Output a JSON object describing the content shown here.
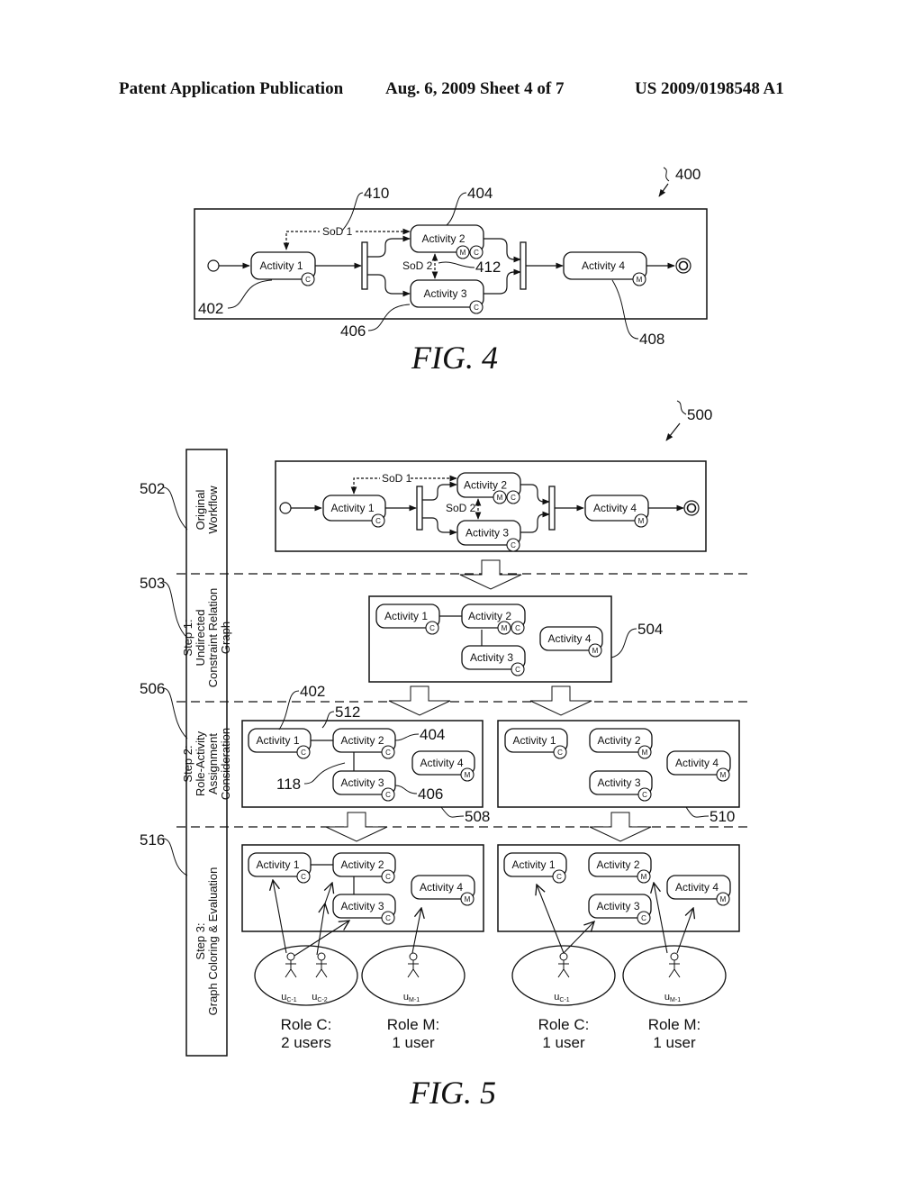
{
  "header": {
    "left": "Patent Application Publication",
    "middle": "Aug. 6, 2009   Sheet 4 of 7",
    "right": "US 2009/0198548 A1"
  },
  "fig4": {
    "caption": "FIG. 4",
    "ref_figure": "400",
    "refs": {
      "activity1": "402",
      "activity2": "404",
      "activity3": "406",
      "activity4": "408",
      "sod1": "410",
      "sod2": "412"
    },
    "activities": [
      {
        "label": "Activity 1",
        "badges": [
          "C"
        ]
      },
      {
        "label": "Activity 2",
        "badges": [
          "M",
          "C"
        ]
      },
      {
        "label": "Activity 3",
        "badges": [
          "C"
        ]
      },
      {
        "label": "Activity 4",
        "badges": [
          "M"
        ]
      }
    ],
    "sod1": "SoD 1",
    "sod2": "SoD 2"
  },
  "fig5": {
    "caption": "FIG. 5",
    "ref_figure": "500",
    "steps": [
      {
        "ref": "502",
        "lines": [
          "Original",
          "Workflow"
        ]
      },
      {
        "ref": "503",
        "lines": [
          "Step 1:",
          "Undirected",
          "Constraint Relation",
          "Graph"
        ]
      },
      {
        "ref": "506",
        "lines": [
          "Step 2:",
          "Role-Activity",
          "Assignment",
          "Consideration"
        ]
      },
      {
        "ref": "516",
        "lines": [
          "Step 3:",
          "Graph Coloring & Evaluation"
        ]
      }
    ],
    "workflow": {
      "activities": [
        {
          "label": "Activity 1",
          "badges": [
            "C"
          ]
        },
        {
          "label": "Activity 2",
          "badges": [
            "M",
            "C"
          ]
        },
        {
          "label": "Activity 3",
          "badges": [
            "C"
          ]
        },
        {
          "label": "Activity 4",
          "badges": [
            "M"
          ]
        }
      ],
      "sod1": "SoD 1",
      "sod2": "SoD 2"
    },
    "graph": {
      "ref": "504",
      "activities": [
        {
          "label": "Activity 1",
          "badges": [
            "C"
          ]
        },
        {
          "label": "Activity 2",
          "badges": [
            "M",
            "C"
          ]
        },
        {
          "label": "Activity 3",
          "badges": [
            "C"
          ]
        },
        {
          "label": "Activity 4",
          "badges": [
            "M"
          ]
        }
      ]
    },
    "step2_left": {
      "ref": "508",
      "refs": {
        "activity1": "402",
        "activity2": "404",
        "activity3": "406",
        "edge12": "512",
        "edge23": "118"
      },
      "activities": [
        {
          "label": "Activity 1",
          "badges": [
            "C"
          ]
        },
        {
          "label": "Activity 2",
          "badges": [
            "C"
          ]
        },
        {
          "label": "Activity 3",
          "badges": [
            "C"
          ]
        },
        {
          "label": "Activity 4",
          "badges": [
            "M"
          ]
        }
      ]
    },
    "step2_right": {
      "ref": "510",
      "activities": [
        {
          "label": "Activity 1",
          "badges": [
            "C"
          ]
        },
        {
          "label": "Activity 2",
          "badges": [
            "M"
          ]
        },
        {
          "label": "Activity 3",
          "badges": [
            "C"
          ]
        },
        {
          "label": "Activity 4",
          "badges": [
            "M"
          ]
        }
      ]
    },
    "step3_left": {
      "activities": [
        {
          "label": "Activity 1",
          "badges": [
            "C"
          ]
        },
        {
          "label": "Activity 2",
          "badges": [
            "C"
          ]
        },
        {
          "label": "Activity 3",
          "badges": [
            "C"
          ]
        },
        {
          "label": "Activity 4",
          "badges": [
            "M"
          ]
        }
      ],
      "roles": [
        {
          "name": "Role C:",
          "count": "2 users",
          "users": [
            "u",
            "u"
          ],
          "subs": [
            "C-1",
            "C-2"
          ]
        },
        {
          "name": "Role M:",
          "count": "1 user",
          "users": [
            "u"
          ],
          "subs": [
            "M-1"
          ]
        }
      ]
    },
    "step3_right": {
      "activities": [
        {
          "label": "Activity 1",
          "badges": [
            "C"
          ]
        },
        {
          "label": "Activity 2",
          "badges": [
            "M"
          ]
        },
        {
          "label": "Activity 3",
          "badges": [
            "C"
          ]
        },
        {
          "label": "Activity 4",
          "badges": [
            "M"
          ]
        }
      ],
      "roles": [
        {
          "name": "Role C:",
          "count": "1 user",
          "users": [
            "u"
          ],
          "subs": [
            "C-1"
          ]
        },
        {
          "name": "Role M:",
          "count": "1 user",
          "users": [
            "u"
          ],
          "subs": [
            "M-1"
          ]
        }
      ]
    }
  }
}
